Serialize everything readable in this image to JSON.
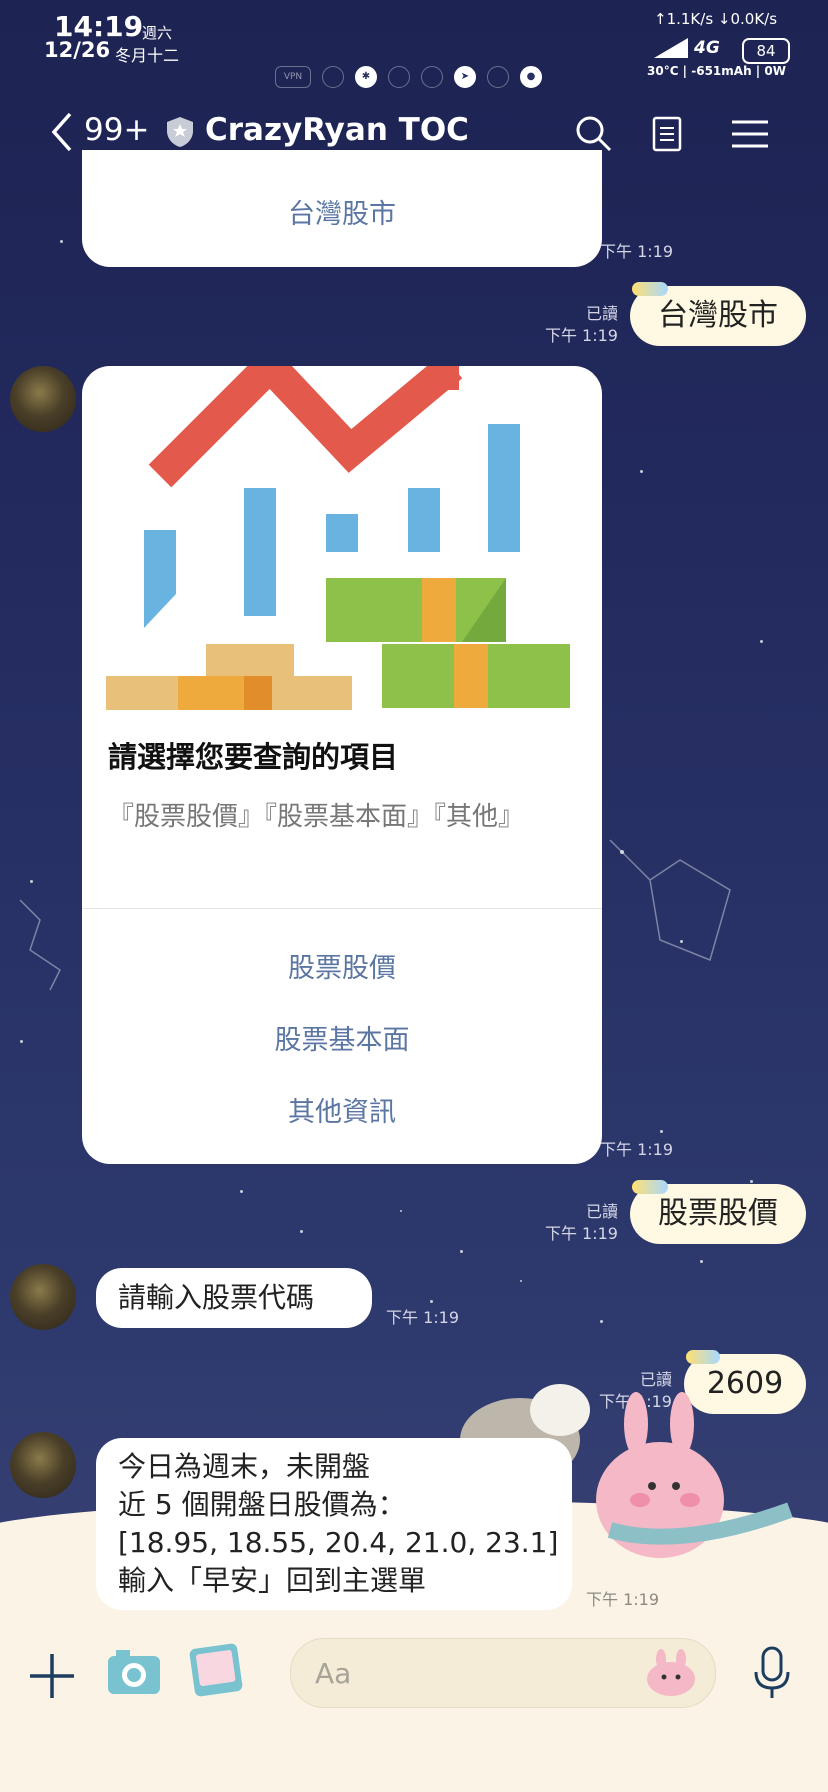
{
  "status_bar": {
    "time": "14:19",
    "weekday": "週六",
    "date": "12/26",
    "lunar": "冬月十二",
    "net_speed": "↑1.1K/s ↓0.0K/s",
    "battery_level": "84",
    "network": "4G",
    "battery_info": "30°C | -651mAh | 0W",
    "vpn": "VPN"
  },
  "header": {
    "back_count": "99+",
    "title": "CrazyRyan TOC",
    "icons": [
      "back-icon",
      "shield-icon",
      "search-icon",
      "notes-icon",
      "menu-icon"
    ]
  },
  "messages": {
    "top_card_option": "台灣股市",
    "ts_top_card": "下午 1:19",
    "sent1": {
      "read": "已讀",
      "time": "下午 1:19",
      "text": "台灣股市"
    },
    "card": {
      "title": "請選擇您要查詢的項目",
      "body": "『股票股價』『股票基本面』『其他』",
      "options": [
        "股票股價",
        "股票基本面",
        "其他資訊"
      ],
      "time": "下午 1:19"
    },
    "sent2": {
      "read": "已讀",
      "time": "下午 1:19",
      "text": "股票股價"
    },
    "reply1": {
      "text": "請輸入股票代碼",
      "time": "下午 1:19"
    },
    "sent3": {
      "read": "已讀",
      "time": "下午 1:19",
      "text": "2609"
    },
    "reply2": {
      "lines": [
        "今日為週末，未開盤",
        "近 5 個開盤日股價為：",
        "[18.95, 18.55, 20.4, 21.0, 23.1]",
        "輸入「早安」回到主選單"
      ],
      "time": "下午 1:19"
    }
  },
  "input_bar": {
    "placeholder": "Aa",
    "icons": [
      "plus-icon",
      "camera-icon",
      "gallery-icon",
      "sticker-icon",
      "mic-icon"
    ]
  },
  "colors": {
    "accent": "#5b76a3",
    "bubble_sent": "#fff8e2",
    "background": "#232a5e"
  }
}
